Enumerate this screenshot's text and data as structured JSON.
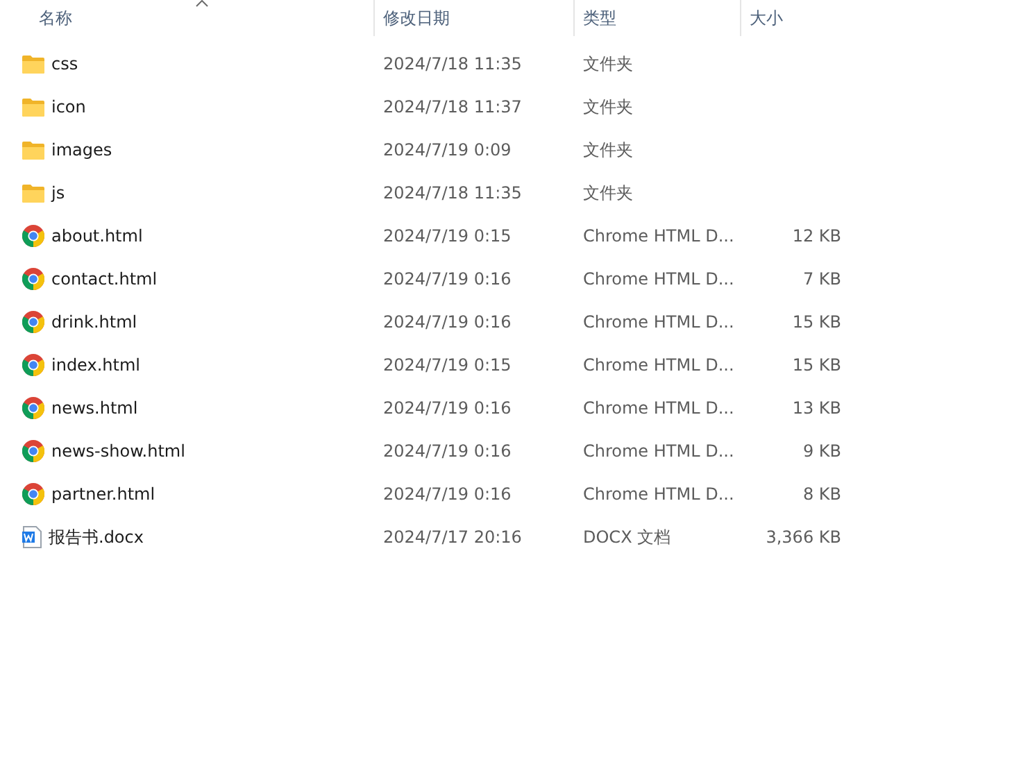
{
  "columns": [
    {
      "label": "名称",
      "sorted": true
    },
    {
      "label": "修改日期",
      "sorted": false
    },
    {
      "label": "类型",
      "sorted": false
    },
    {
      "label": "大小",
      "sorted": false
    }
  ],
  "rows": [
    {
      "kind": "folder",
      "name": "css",
      "date": "2024/7/18 11:35",
      "type": "文件夹"
    },
    {
      "kind": "folder",
      "name": "icon",
      "date": "2024/7/18 11:37",
      "type": "文件夹"
    },
    {
      "kind": "folder",
      "name": "images",
      "date": "2024/7/19 0:09",
      "type": "文件夹"
    },
    {
      "kind": "folder",
      "name": "js",
      "date": "2024/7/18 11:35",
      "type": "文件夹"
    },
    {
      "kind": "chrome",
      "name": "about.html",
      "date": "2024/7/19 0:15",
      "type": "Chrome HTML D...",
      "size": "12 KB"
    },
    {
      "kind": "chrome",
      "name": "contact.html",
      "date": "2024/7/19 0:16",
      "type": "Chrome HTML D...",
      "size": "7 KB"
    },
    {
      "kind": "chrome",
      "name": "drink.html",
      "date": "2024/7/19 0:16",
      "type": "Chrome HTML D...",
      "size": "15 KB"
    },
    {
      "kind": "chrome",
      "name": "index.html",
      "date": "2024/7/19 0:15",
      "type": "Chrome HTML D...",
      "size": "15 KB"
    },
    {
      "kind": "chrome",
      "name": "news.html",
      "date": "2024/7/19 0:16",
      "type": "Chrome HTML D...",
      "size": "13 KB"
    },
    {
      "kind": "chrome",
      "name": "news-show.html",
      "date": "2024/7/19 0:16",
      "type": "Chrome HTML D...",
      "size": "9 KB"
    },
    {
      "kind": "chrome",
      "name": "partner.html",
      "date": "2024/7/19 0:16",
      "type": "Chrome HTML D...",
      "size": "8 KB"
    },
    {
      "kind": "docx",
      "name": "报告书.docx",
      "date": "2024/7/17 20:16",
      "type": "DOCX 文档",
      "size": "3,366 KB"
    }
  ]
}
